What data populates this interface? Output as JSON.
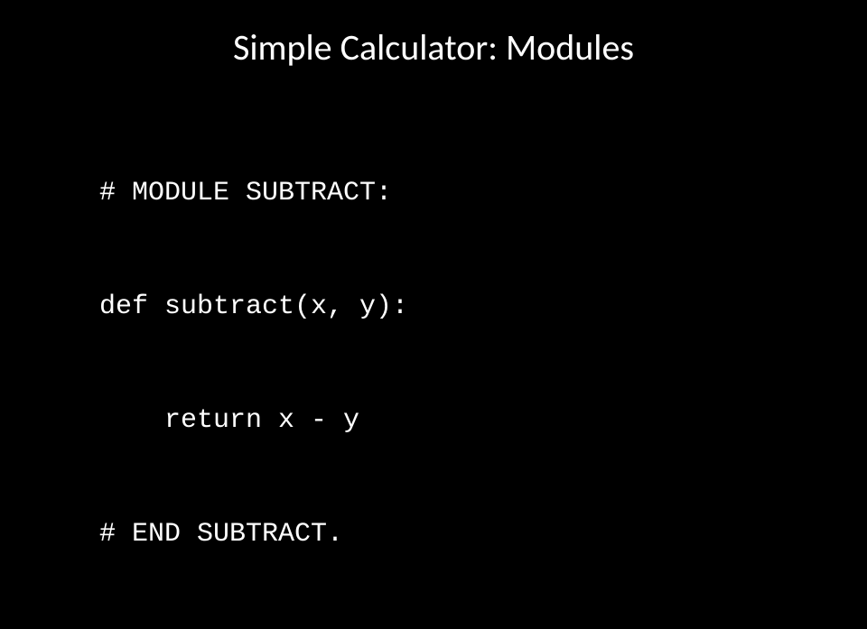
{
  "slide": {
    "title": "Simple Calculator: Modules",
    "code": {
      "line1": "# MODULE SUBTRACT:",
      "line2": "def subtract(x, y):",
      "line3": "    return x - y",
      "line4": "# END SUBTRACT."
    }
  }
}
